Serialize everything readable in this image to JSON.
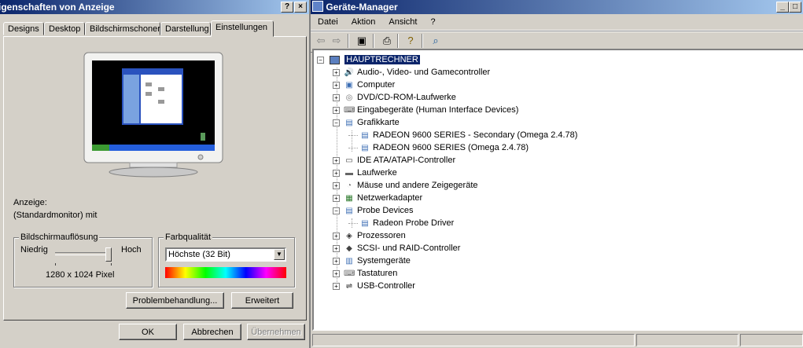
{
  "display_props": {
    "title": "Eigenschaften von Anzeige",
    "title_buttons": [
      "?",
      "×"
    ],
    "tabs": [
      "Designs",
      "Desktop",
      "Bildschirmschoner",
      "Darstellung",
      "Einstellungen"
    ],
    "active_tab": "Einstellungen",
    "display_label": "Anzeige:",
    "display_value": "(Standardmonitor) mit",
    "resolution": {
      "group_label": "Bildschirmauflösung",
      "low_label": "Niedrig",
      "high_label": "Hoch",
      "value_text": "1280 x 1024 Pixel",
      "slider_position_fraction": 0.97
    },
    "color": {
      "group_label": "Farbqualität",
      "selected": "Höchste (32 Bit)",
      "dropdown_arrow": "▼"
    },
    "buttons": {
      "troubleshoot": "Problembehandlung...",
      "advanced": "Erweitert",
      "ok": "OK",
      "cancel": "Abbrechen",
      "apply": "Übernehmen"
    }
  },
  "device_manager": {
    "title": "Geräte-Manager",
    "title_buttons": [
      "_",
      "□"
    ],
    "menu": [
      "Datei",
      "Aktion",
      "Ansicht",
      "?"
    ],
    "toolbar_icons": [
      "back-arrow-icon",
      "forward-arrow-icon",
      "properties-icon",
      "print-icon",
      "help-icon",
      "scan-icon"
    ],
    "root": "HAUPTRECHNER",
    "tree": [
      {
        "label": "Audio-, Video- und Gamecontroller",
        "level": 1,
        "expander": "+",
        "icon": "audio-icon"
      },
      {
        "label": "Computer",
        "level": 1,
        "expander": "+",
        "icon": "computer-icon"
      },
      {
        "label": "DVD/CD-ROM-Laufwerke",
        "level": 1,
        "expander": "+",
        "icon": "dvd-icon"
      },
      {
        "label": "Eingabegeräte (Human Interface Devices)",
        "level": 1,
        "expander": "+",
        "icon": "hid-icon"
      },
      {
        "label": "Grafikkarte",
        "level": 1,
        "expander": "−",
        "icon": "display-adapter-icon"
      },
      {
        "label": "RADEON 9600 SERIES - Secondary (Omega 2.4.78)",
        "level": 2,
        "expander": "",
        "icon": "display-adapter-icon"
      },
      {
        "label": "RADEON 9600 SERIES (Omega 2.4.78)",
        "level": 2,
        "expander": "",
        "icon": "display-adapter-icon"
      },
      {
        "label": "IDE ATA/ATAPI-Controller",
        "level": 1,
        "expander": "+",
        "icon": "ide-icon"
      },
      {
        "label": "Laufwerke",
        "level": 1,
        "expander": "+",
        "icon": "disk-drive-icon"
      },
      {
        "label": "Mäuse und andere Zeigegeräte",
        "level": 1,
        "expander": "+",
        "icon": "mouse-icon"
      },
      {
        "label": "Netzwerkadapter",
        "level": 1,
        "expander": "+",
        "icon": "network-adapter-icon"
      },
      {
        "label": "Probe Devices",
        "level": 1,
        "expander": "−",
        "icon": "monitor-icon"
      },
      {
        "label": "Radeon Probe Driver",
        "level": 2,
        "expander": "",
        "icon": "monitor-icon"
      },
      {
        "label": "Prozessoren",
        "level": 1,
        "expander": "+",
        "icon": "processor-icon"
      },
      {
        "label": "SCSI- und RAID-Controller",
        "level": 1,
        "expander": "+",
        "icon": "scsi-icon"
      },
      {
        "label": "Systemgeräte",
        "level": 1,
        "expander": "+",
        "icon": "system-device-icon"
      },
      {
        "label": "Tastaturen",
        "level": 1,
        "expander": "+",
        "icon": "keyboard-icon"
      },
      {
        "label": "USB-Controller",
        "level": 1,
        "expander": "+",
        "icon": "usb-icon"
      }
    ]
  }
}
